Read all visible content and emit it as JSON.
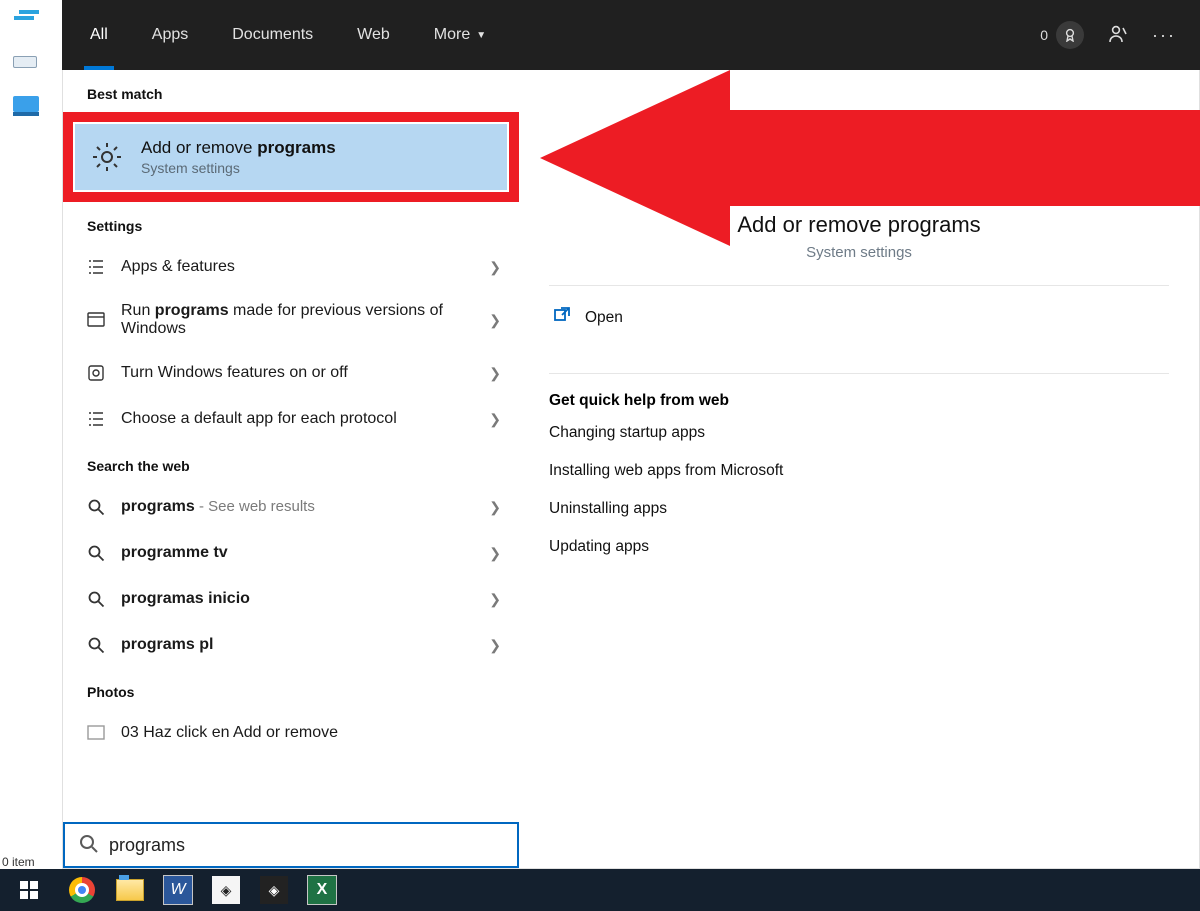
{
  "tabs": {
    "all": "All",
    "apps": "Apps",
    "documents": "Documents",
    "web": "Web",
    "more": "More"
  },
  "topbar": {
    "count": "0"
  },
  "sections": {
    "best_match": "Best match",
    "settings": "Settings",
    "search_web": "Search the web",
    "photos": "Photos"
  },
  "best_match_item": {
    "title_pre": "Add or remove ",
    "title_bold": "programs",
    "subtitle": "System settings"
  },
  "settings_items": [
    {
      "label": "Apps & features"
    },
    {
      "label_html": "Run <b>programs</b> made for previous versions of Windows"
    },
    {
      "label": "Turn Windows features on or off"
    },
    {
      "label": "Choose a default app for each protocol"
    }
  ],
  "web_items": [
    {
      "bold": "programs",
      "suffix": " - See web results"
    },
    {
      "bold": "programme tv"
    },
    {
      "bold": "programas inicio"
    },
    {
      "bold": "programs pl"
    }
  ],
  "photo_item": {
    "label": "03 Haz click en Add or remove"
  },
  "search": {
    "value": "programs"
  },
  "preview": {
    "title": "Add or remove programs",
    "subtitle": "System settings",
    "open": "Open",
    "quick_head": "Get quick help from web",
    "links": [
      "Changing startup apps",
      "Installing web apps from Microsoft",
      "Uninstalling apps",
      "Updating apps"
    ]
  },
  "desktop_footer": "0 item"
}
